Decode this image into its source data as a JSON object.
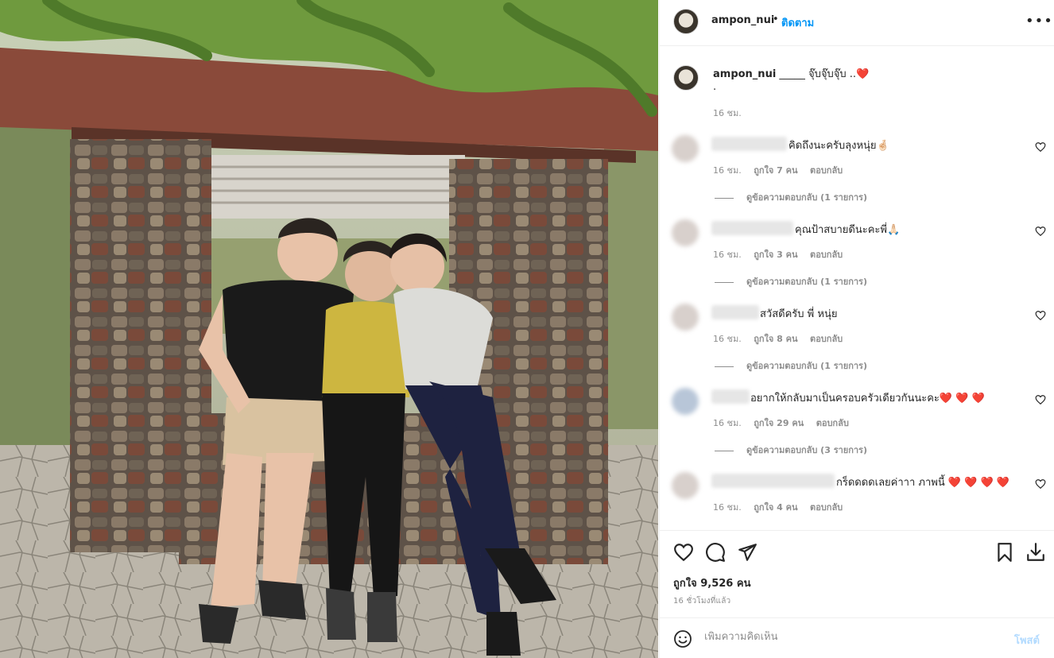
{
  "post": {
    "username": "ampon_nui",
    "follow_label": "ติดตาม",
    "more_icon": "ellipsis-icon"
  },
  "caption": {
    "username": "ampon_nui",
    "text": "_____ จุ๊บจุ๊บจุ๊บ ..❤️",
    "second_line": ".",
    "time": "16 ชม."
  },
  "comments": [
    {
      "text": "คิดถึงนะครับลุงหนุ่ย🤞🏻",
      "time": "16 ชม.",
      "likes": "ถูกใจ 7 คน",
      "reply": "ตอบกลับ",
      "view_replies": "ดูข้อความตอบกลับ (1 รายการ)"
    },
    {
      "text": "คุณป้าสบายดีนะคะพี่🙏🏻",
      "time": "16 ชม.",
      "likes": "ถูกใจ 3 คน",
      "reply": "ตอบกลับ",
      "view_replies": "ดูข้อความตอบกลับ (1 รายการ)"
    },
    {
      "text": "สวัสดีครับ พี่ หนุ่ย",
      "time": "16 ชม.",
      "likes": "ถูกใจ 8 คน",
      "reply": "ตอบกลับ",
      "view_replies": "ดูข้อความตอบกลับ (1 รายการ)"
    },
    {
      "text": "อยากให้กลับมาเป็นครอบครัวเดียวกันนะคะ❤️ ❤️ ❤️",
      "time": "16 ชม.",
      "likes": "ถูกใจ 29 คน",
      "reply": "ตอบกลับ",
      "view_replies": "ดูข้อความตอบกลับ (3 รายการ)"
    },
    {
      "text": "กร็ดดดดเลยค่าาา ภาพนี้ ❤️ ❤️ ❤️ ❤️",
      "time": "16 ชม.",
      "likes": "ถูกใจ 4 คน",
      "reply": "ตอบกลับ",
      "view_replies": ""
    }
  ],
  "actions": {
    "like_icon": "heart-outline-icon",
    "comment_icon": "comment-icon",
    "share_icon": "paper-plane-icon",
    "save_icon": "bookmark-icon",
    "download_icon": "download-icon",
    "likes_text": "ถูกใจ 9,526 คน",
    "time_ago": "16 ชั่วโมงที่แล้ว"
  },
  "add_comment": {
    "placeholder": "เพิ่มความคิดเห็น",
    "post_label": "โพสต์"
  },
  "colors": {
    "link_blue": "#0095f6",
    "post_disabled": "#b3dbff",
    "secondary_text": "#8e8e8e",
    "heart_red": "#ed4956"
  }
}
